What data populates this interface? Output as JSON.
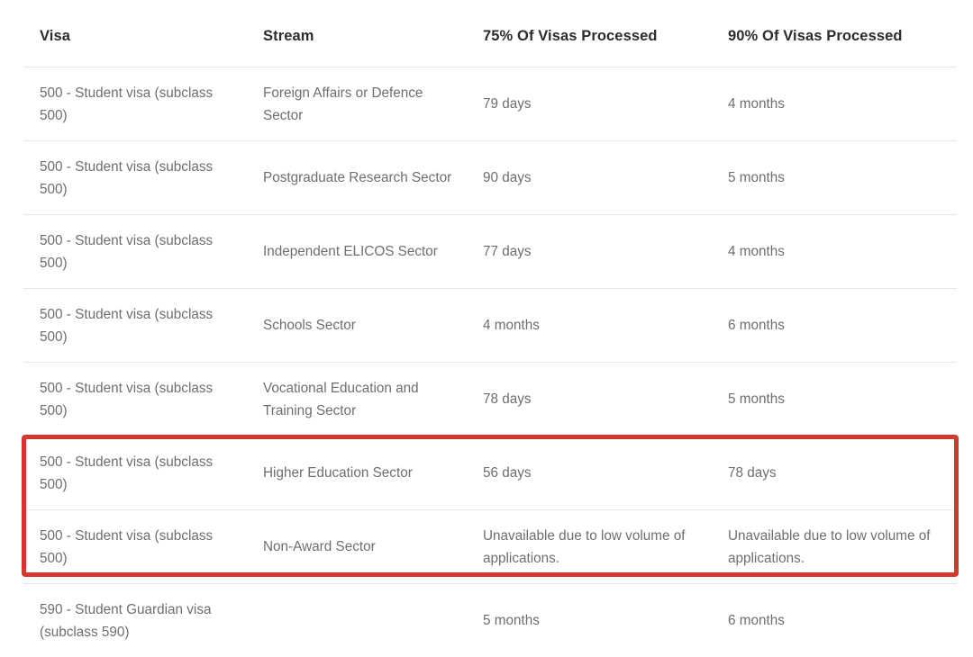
{
  "table": {
    "columns": [
      {
        "key": "visa",
        "label": "Visa"
      },
      {
        "key": "stream",
        "label": "Stream"
      },
      {
        "key": "p75",
        "label": "75% Of Visas Processed"
      },
      {
        "key": "p90",
        "label": "90% Of Visas Processed"
      }
    ],
    "rows": [
      {
        "visa": "500 - Student visa (subclass 500)",
        "stream": "Foreign Affairs or Defence Sector",
        "p75": "79 days",
        "p90": "4 months",
        "highlighted": false
      },
      {
        "visa": "500 - Student visa (subclass 500)",
        "stream": "Postgraduate Research Sector",
        "p75": "90 days",
        "p90": "5 months",
        "highlighted": false
      },
      {
        "visa": "500 - Student visa (subclass 500)",
        "stream": "Independent ELICOS Sector",
        "p75": "77 days",
        "p90": "4 months",
        "highlighted": false
      },
      {
        "visa": "500 - Student visa (subclass 500)",
        "stream": "Schools Sector",
        "p75": "4 months",
        "p90": "6 months",
        "highlighted": false
      },
      {
        "visa": "500 - Student visa (subclass 500)",
        "stream": "Vocational Education and Training Sector",
        "p75": "78 days",
        "p90": "5 months",
        "highlighted": false
      },
      {
        "visa": "500 - Student visa (subclass 500)",
        "stream": "Higher Education Sector",
        "p75": "56 days",
        "p90": "78 days",
        "highlighted": true
      },
      {
        "visa": "500 - Student visa (subclass 500)",
        "stream": "Non-Award Sector",
        "p75": "Unavailable due to low volume of applications.",
        "p90": "Unavailable due to low volume of applications.",
        "highlighted": true
      },
      {
        "visa": "590 - Student Guardian visa (subclass 590)",
        "stream": "",
        "p75": "5 months",
        "p90": "6 months",
        "highlighted": false
      }
    ]
  },
  "annotation": {
    "type": "highlight-rectangle",
    "color": "#d3382f",
    "covers_rows": [
      "Higher Education Sector",
      "Non-Award Sector"
    ]
  },
  "colors": {
    "header_text": "#2c2c2c",
    "body_text": "#6e6e6e",
    "row_divider": "#e9e9e9",
    "background": "#ffffff",
    "highlight": "#d3382f"
  }
}
